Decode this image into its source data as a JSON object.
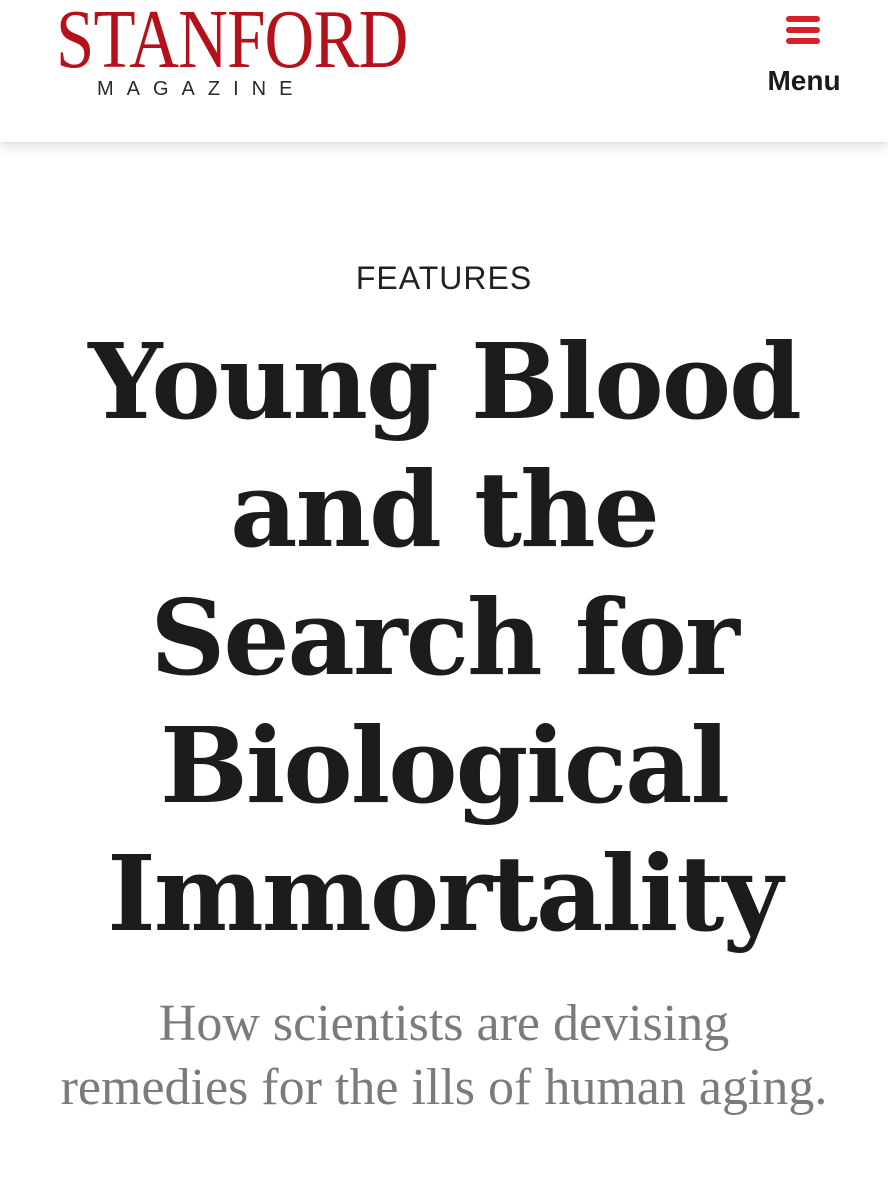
{
  "header": {
    "logo": {
      "wordmark": "STANFORD",
      "subtitle": "MAGAZINE"
    },
    "menu": {
      "icon": "hamburger-icon",
      "label": "Menu"
    }
  },
  "article": {
    "category": "FEATURES",
    "title": "Young Blood and the Search for Biological Immortality",
    "dek": "How scientists are devising remedies for the ills of human aging."
  },
  "colors": {
    "brand_red": "#b5111a",
    "menu_icon_red": "#d8202a",
    "headline_text": "#1c1c1c",
    "dek_text": "#7b7b7b"
  }
}
